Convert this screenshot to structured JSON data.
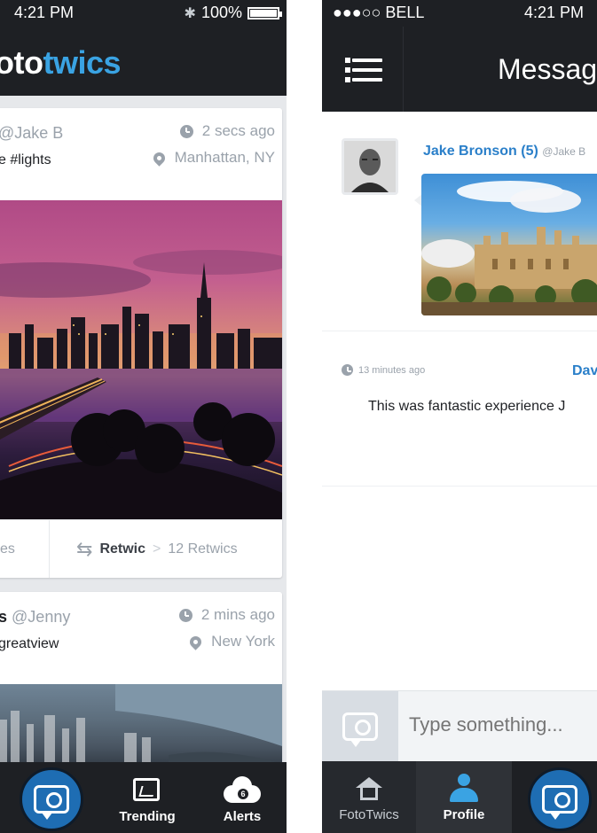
{
  "left_screen": {
    "status": {
      "time": "4:21 PM",
      "battery": "100%",
      "battery_level": 1.0,
      "bluetooth_icon": "bluetooth-icon"
    },
    "logo": {
      "part1": "oto",
      "part2": "twics"
    },
    "posts": [
      {
        "handle": "@Jake B",
        "caption": "e #lights",
        "time": "2 secs ago",
        "location": "Manhattan, NY",
        "likes_fragment": "es",
        "retwic_label": "Retwic",
        "retwic_separator": ">",
        "retwic_count": "12 Retwics"
      },
      {
        "user_fragment": "s",
        "handle": "@Jenny",
        "caption": "greatview",
        "time": "2 mins ago",
        "location": "New York"
      }
    ],
    "tabbar": {
      "trending_label": "Trending",
      "alerts_label": "Alerts",
      "alerts_badge": "6"
    }
  },
  "right_screen": {
    "status": {
      "carrier": "●●●○○ BELL",
      "time": "4:21 PM"
    },
    "title": "Messages",
    "messages": [
      {
        "sender": "Jake Bronson (5)",
        "handle": "@Jake B"
      },
      {
        "time": "13 minutes ago",
        "sender": "Dav",
        "text": "This was fantastic experience J"
      }
    ],
    "composer": {
      "placeholder": "Type something..."
    },
    "tabbar": {
      "fototwics_label": "FotoTwics",
      "profile_label": "Profile"
    }
  },
  "colors": {
    "accent": "#3aa3e3",
    "link": "#2a7fc9",
    "bar": "#1e2024",
    "fab": "#1e6db3"
  }
}
